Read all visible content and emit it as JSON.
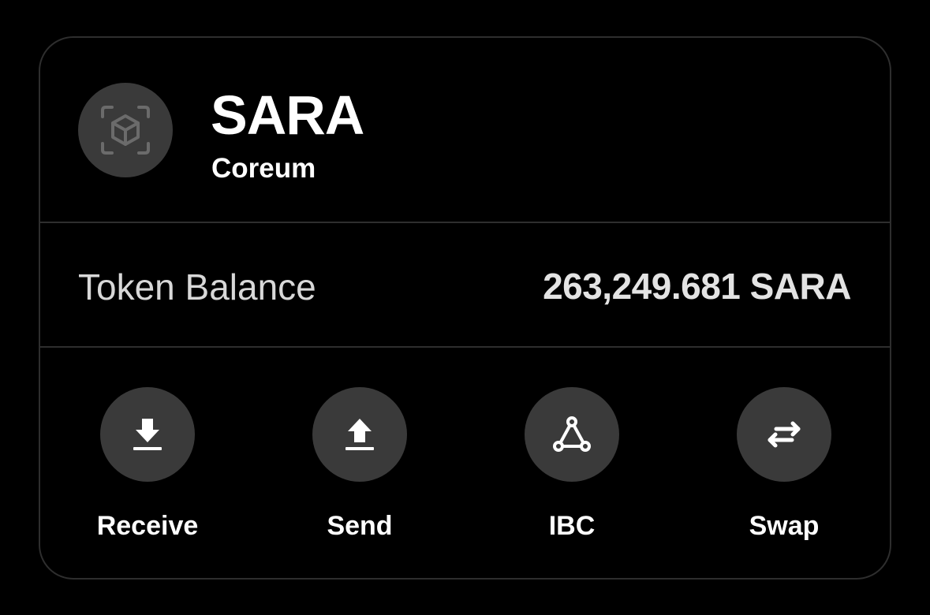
{
  "token": {
    "symbol": "SARA",
    "chain": "Coreum",
    "icon": "cube-scan-icon"
  },
  "balance": {
    "label": "Token Balance",
    "value": "263,249.681 SARA"
  },
  "actions": [
    {
      "label": "Receive",
      "icon": "download-icon"
    },
    {
      "label": "Send",
      "icon": "upload-icon"
    },
    {
      "label": "IBC",
      "icon": "ibc-triangle-icon"
    },
    {
      "label": "Swap",
      "icon": "swap-arrows-icon"
    }
  ],
  "colors": {
    "background": "#000000",
    "card_border": "#2e2e2e",
    "circle": "#3a3a3a",
    "text": "#ffffff"
  }
}
